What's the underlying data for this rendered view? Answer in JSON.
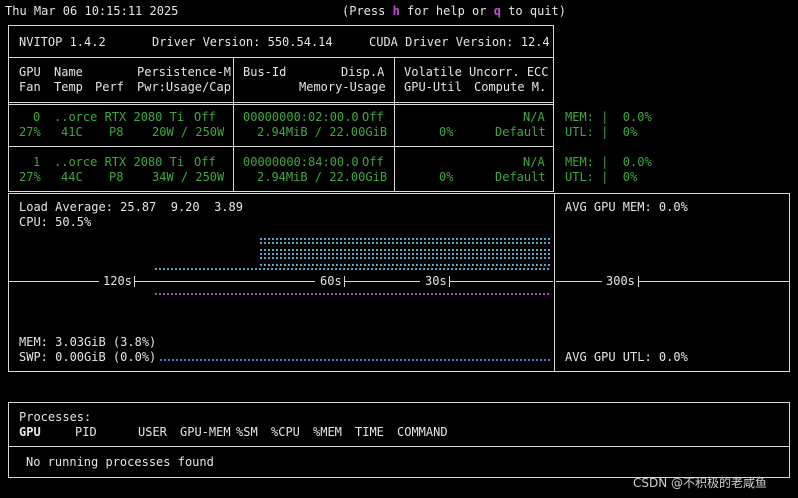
{
  "topbar": {
    "datetime": "Thu Mar 06 10:15:11 2025",
    "help_open": "(Press ",
    "help_h": "h",
    "help_mid": " for help or ",
    "help_q": "q",
    "help_close": " to quit)"
  },
  "header": {
    "nvitop_version": "NVITOP 1.4.2",
    "driver_version": "Driver Version: 550.54.14",
    "cuda_version": "CUDA Driver Version: 12.4"
  },
  "columns": {
    "row1": {
      "gpu": "GPU",
      "name": "Name",
      "persistence": "Persistence-M",
      "busid": "Bus-Id",
      "dispa": "Disp.A",
      "volatile": "Volatile Uncorr. ECC"
    },
    "row2": {
      "fan": "Fan",
      "temp": "Temp",
      "perf": "Perf",
      "pwr": "Pwr:Usage/Cap",
      "memusage": "Memory-Usage",
      "gpuutil": "GPU-Util",
      "compute": "Compute M."
    }
  },
  "gpus": [
    {
      "index": "0",
      "name": "..orce RTX 2080 Ti",
      "persistence": "Off",
      "bus_id": "00000000:02:00.0",
      "disp": "Off",
      "ecc": "N/A",
      "fan": "27%",
      "temp": "41C",
      "perf": "P8",
      "power": "20W / 250W",
      "memory": "2.94MiB / 22.00GiB",
      "util": "0%",
      "compute": "Default",
      "mem_bar": "MEM: |  0.0%",
      "utl_bar": "UTL: |  0%"
    },
    {
      "index": "1",
      "name": "..orce RTX 2080 Ti",
      "persistence": "Off",
      "bus_id": "00000000:84:00.0",
      "disp": "Off",
      "ecc": "N/A",
      "fan": "27%",
      "temp": "44C",
      "perf": "P8",
      "power": "34W / 250W",
      "memory": "2.94MiB / 22.00GiB",
      "util": "0%",
      "compute": "Default",
      "mem_bar": "MEM: |  0.0%",
      "utl_bar": "UTL: |  0%"
    }
  ],
  "host": {
    "load_average": "Load Average: 25.87  9.20  3.89",
    "cpu": "CPU: 50.5%",
    "mem": "MEM: 3.03GiB (3.8%)",
    "swp": "SWP: 0.00GiB (0.0%)",
    "avg_gpu_mem": "AVG GPU MEM: 0.0%",
    "avg_gpu_utl": "AVG GPU UTL: 0.0%",
    "time_labels": {
      "t120": "120s",
      "t60": "60s",
      "t30": "30s",
      "t300": "300s"
    }
  },
  "processes": {
    "title": "Processes:",
    "headers": {
      "gpu": "GPU",
      "pid": "PID",
      "user": "USER",
      "gpumem": "GPU-MEM",
      "sm": "%SM",
      "cpu": "%CPU",
      "mem": "%MEM",
      "time": "TIME",
      "command": "COMMAND"
    },
    "empty_message": "No running processes found"
  },
  "watermark": "CSDN @不积极的老咸鱼",
  "colors": {
    "gpu_text": "#3fa83f",
    "key_hint": "#c64bd6",
    "cpu_graph": "#5aa6c8",
    "memory_graph": "#5e6fd6",
    "gpu_graph": "#a34bc4",
    "border": "#d8d8d8"
  }
}
